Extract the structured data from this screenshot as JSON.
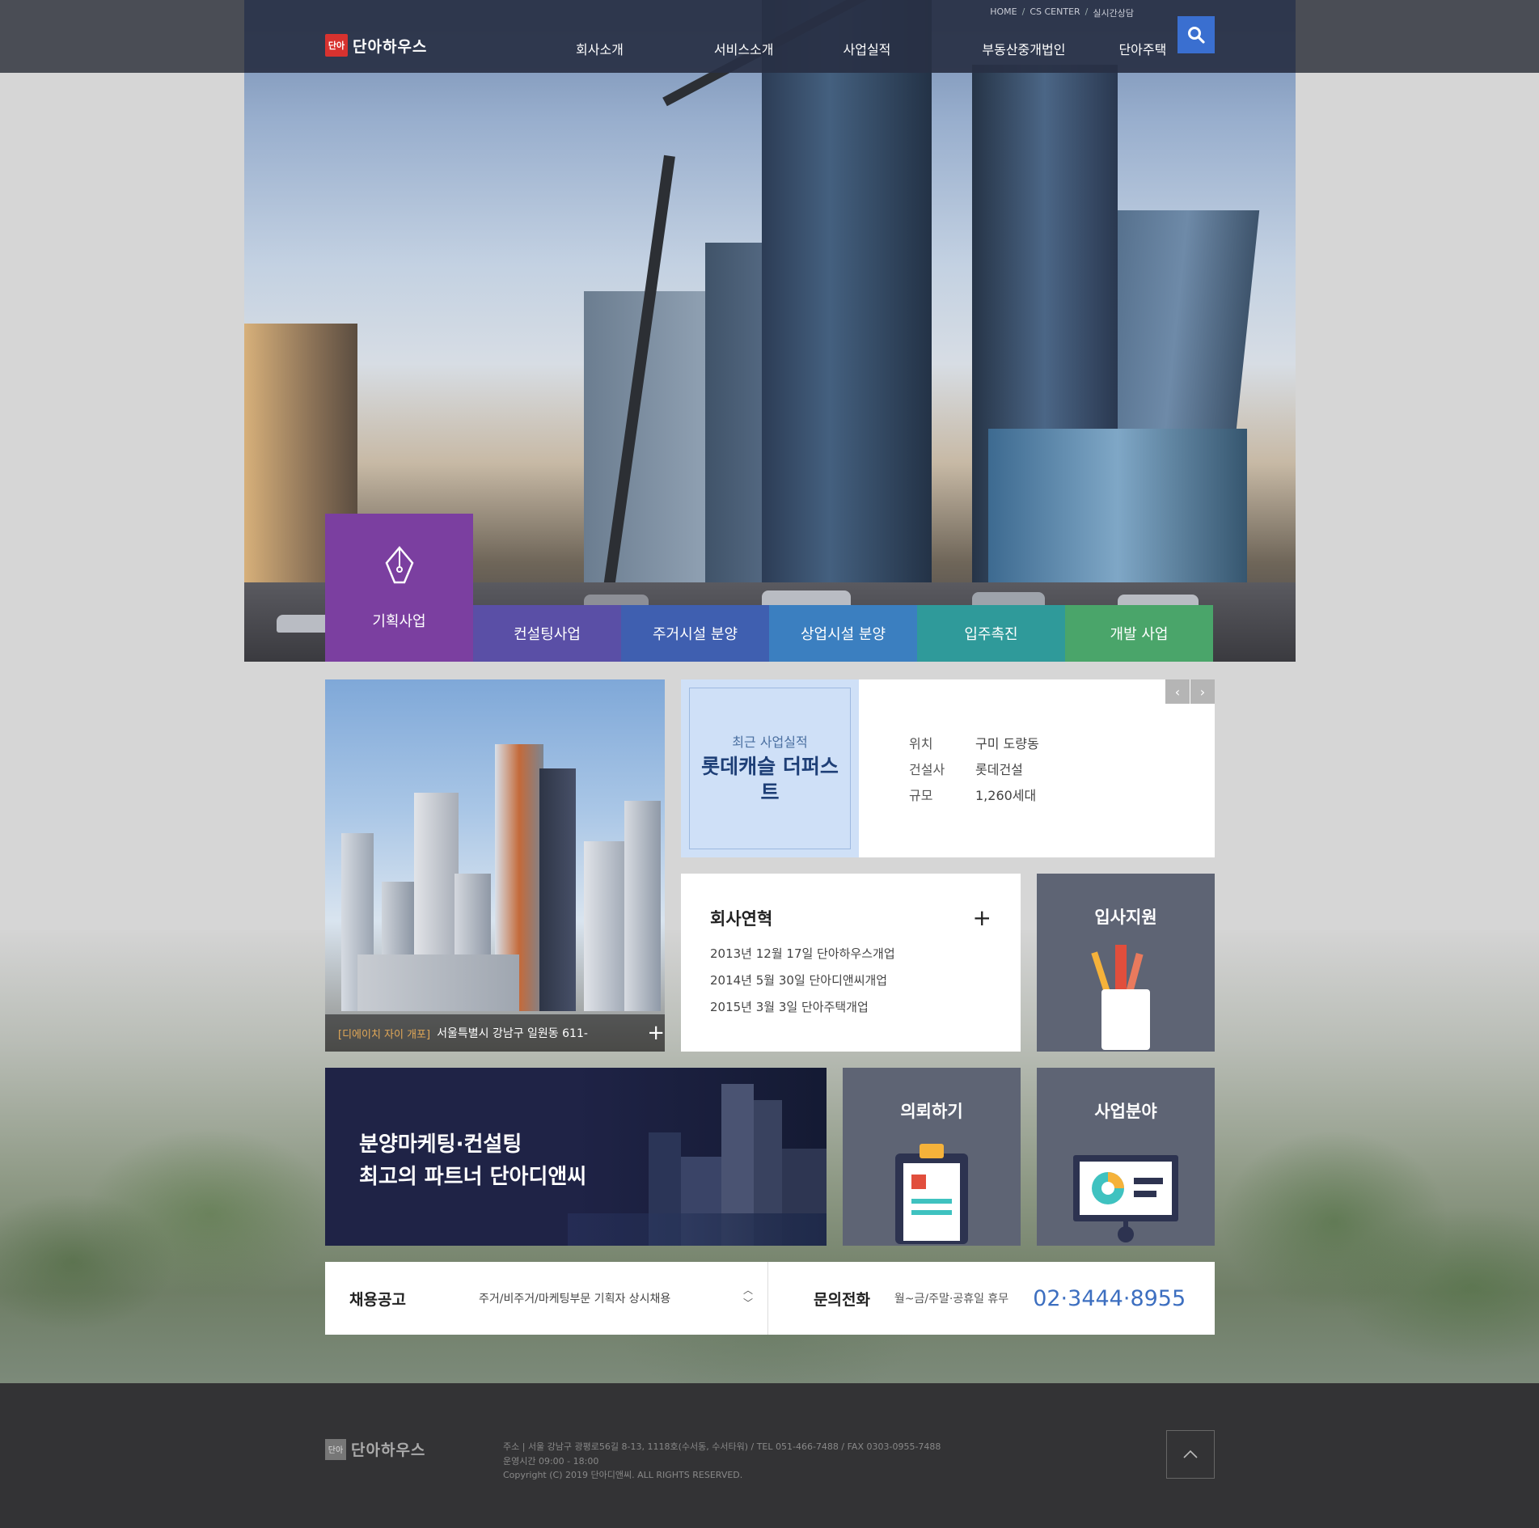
{
  "header": {
    "logo_mark": "단아",
    "logo_text": "단아하우스",
    "utility": [
      "HOME",
      "CS CENTER",
      "실시간상담"
    ],
    "nav": [
      "회사소개",
      "서비스소개",
      "사업실적",
      "부동산중개법인",
      "단아주택"
    ]
  },
  "categories": [
    {
      "label": "기획사업",
      "color": "#7b3fa0"
    },
    {
      "label": "컨설팅사업",
      "color": "#5a4fa6"
    },
    {
      "label": "주거시설 분양",
      "color": "#3f5fb0"
    },
    {
      "label": "상업시설 분양",
      "color": "#3b7fc0"
    },
    {
      "label": "입주촉진",
      "color": "#2f9a9a"
    },
    {
      "label": "개발 사업",
      "color": "#4aa56a"
    }
  ],
  "photo": {
    "tag": "[디에이치 자이 개포]",
    "address": "서울특별시 강남구 일원동 611-"
  },
  "performance": {
    "label": "최근 사업실적",
    "title": "롯데캐슬 더퍼스트",
    "rows": [
      {
        "key": "위치",
        "value": "구미 도량동"
      },
      {
        "key": "건설사",
        "value": "롯데건설"
      },
      {
        "key": "규모",
        "value": "1,260세대"
      }
    ]
  },
  "history": {
    "title": "회사연혁",
    "items": [
      "2013년 12월 17일 단아하우스개업",
      "2014년 5월 30일 단아디앤씨개업",
      "2015년 3월 3일 단아주택개업"
    ]
  },
  "tiles": {
    "apply": "입사지원",
    "request": "의뢰하기",
    "business": "사업분야"
  },
  "banner": {
    "line1": "분양마케팅·컨설팅",
    "line2": "최고의 파트너 단아디앤씨"
  },
  "recruit": {
    "label": "채용공고",
    "text": "주거/비주거/마케팅부문 기획자 상시채용"
  },
  "contact": {
    "label": "문의전화",
    "hours": "월~금/주말·공휴일 휴무",
    "tel": "02·3444·8955"
  },
  "footer": {
    "logo_mark": "단아",
    "logo_text": "단아하우스",
    "address": "주소 | 서울 강남구 광평로56길 8-13, 1118호(수서동, 수서타워) / TEL 051-466-7488 / FAX 0303-0955-7488",
    "hours": "운영시간 09:00 - 18:00",
    "copyright": "Copyright (C) 2019 단아디앤씨. ALL RIGHTS RESERVED."
  }
}
